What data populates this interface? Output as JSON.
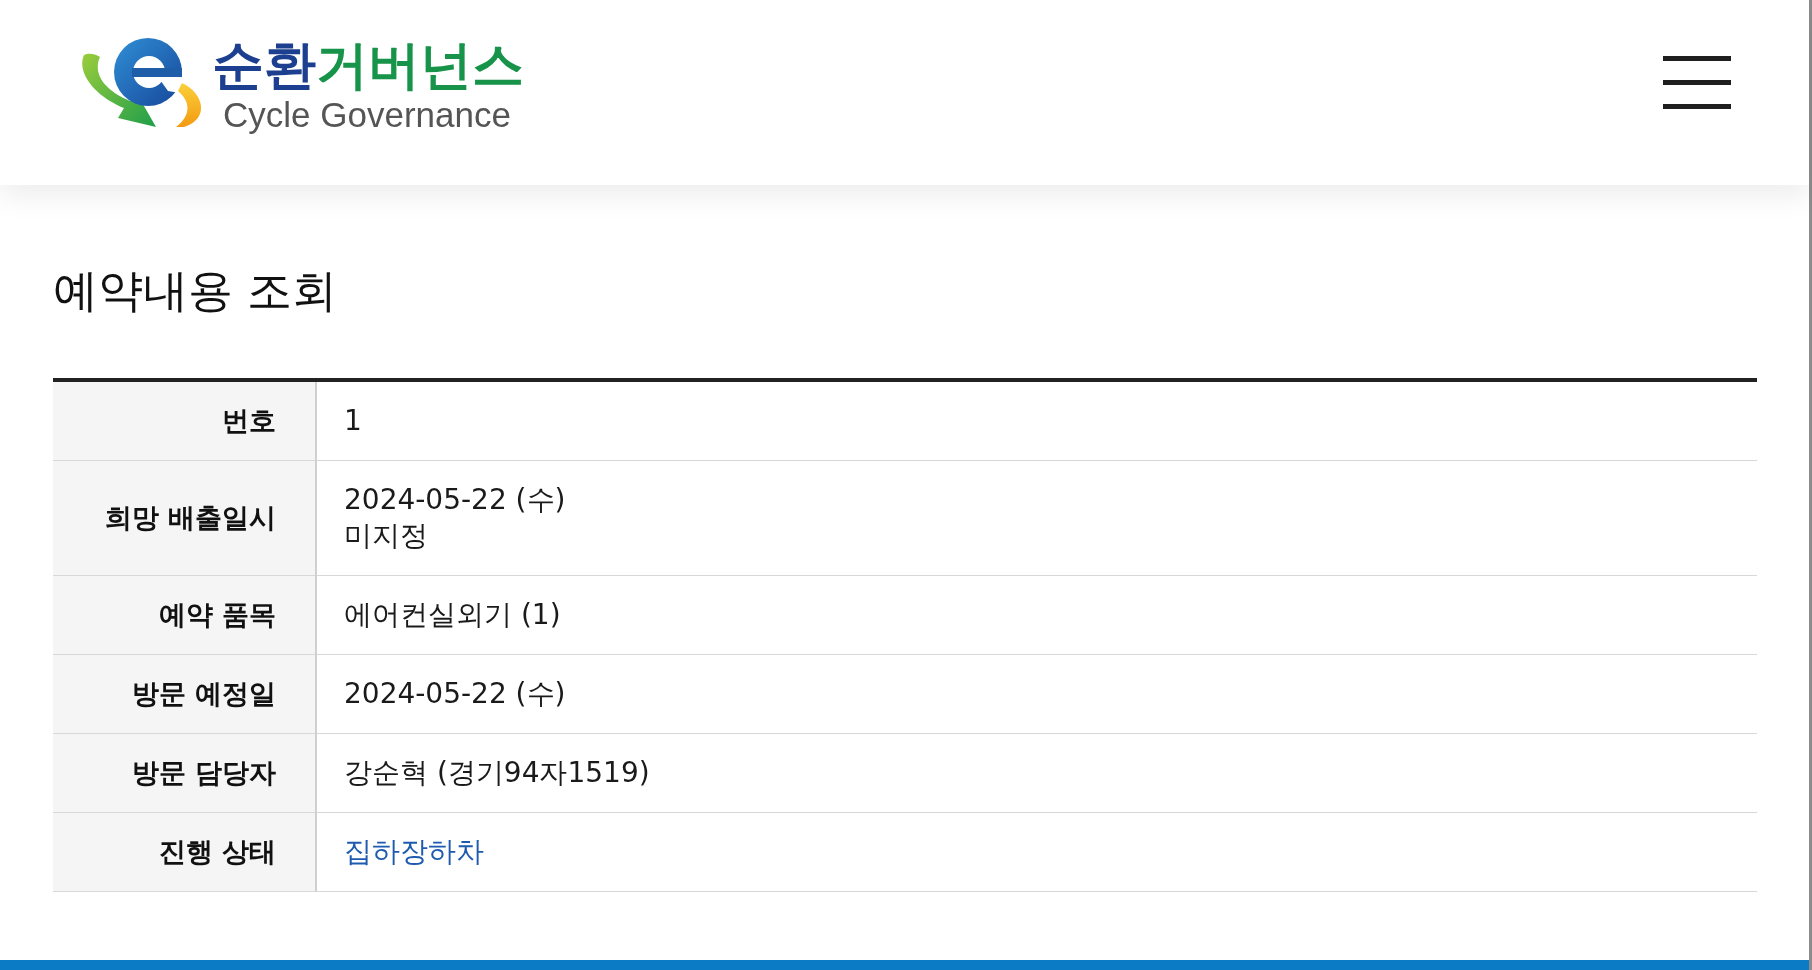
{
  "header": {
    "logo": {
      "title_parts": [
        {
          "text": "순환",
          "color": "#1d3f8f"
        },
        {
          "text": "거버넌스",
          "color": "#17944a"
        }
      ],
      "subtitle": "Cycle Governance"
    }
  },
  "page": {
    "title": "예약내용 조회"
  },
  "table": {
    "rows": [
      {
        "label": "번호",
        "kind": "text",
        "lines": [
          "1"
        ]
      },
      {
        "label": "희망 배출일시",
        "kind": "text",
        "lines": [
          "2024-05-22 (수)",
          "미지정"
        ]
      },
      {
        "label": "예약 품목",
        "kind": "text",
        "lines": [
          "에어컨실외기 (1)"
        ]
      },
      {
        "label": "방문 예정일",
        "kind": "text",
        "lines": [
          "2024-05-22 (수)"
        ]
      },
      {
        "label": "방문 담당자",
        "kind": "text",
        "lines": [
          "강순혁 (경기94자1519)"
        ]
      },
      {
        "label": "진행 상태",
        "kind": "status",
        "lines": [
          "집하장하차"
        ]
      }
    ]
  }
}
